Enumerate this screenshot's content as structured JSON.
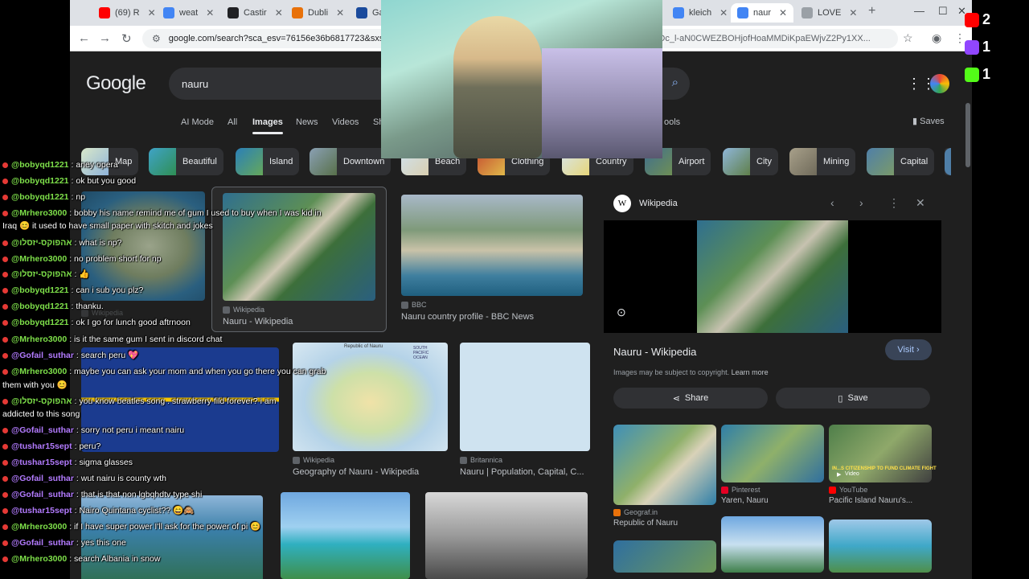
{
  "browser": {
    "tabs": [
      {
        "label": "(69) R",
        "color": "#ff0000",
        "active": false
      },
      {
        "label": "weat",
        "color": "#4285f4",
        "active": false
      },
      {
        "label": "Castir",
        "color": "#202124",
        "active": false
      },
      {
        "label": "Dubli",
        "color": "#e8710a",
        "active": false
      },
      {
        "label": "Ga",
        "color": "#1a4a9c",
        "active": false
      },
      {
        "label": "kleich",
        "color": "#4285f4",
        "active": false
      },
      {
        "label": "naur",
        "color": "#4285f4",
        "active": true
      },
      {
        "label": "LOVE",
        "color": "#9aa0a6",
        "active": false
      }
    ],
    "new_tab_icon": "+",
    "url": "google.com/search?sca_esv=76156e36b6817723&sxsr",
    "url_tail": "fbs=ADc_l-aN0CWEZBOHjofHoaMMDiKpaEWjvZ2Py1XX..."
  },
  "google": {
    "logo": "Google",
    "query": "nauru",
    "tabs": [
      "AI Mode",
      "All",
      "Images",
      "News",
      "Videos",
      "Sh",
      "ools"
    ],
    "active_tab": "Images",
    "saves": "Saves",
    "chips": [
      "Map",
      "Beautiful",
      "Island",
      "Downtown",
      "Beach",
      "Clothing",
      "Country",
      "Airport",
      "City",
      "Mining",
      "Capital"
    ],
    "results": [
      {
        "source": "Wikipedia",
        "caption": "Nauru - Wikipedia"
      },
      {
        "source": "BBC",
        "caption": "Nauru country profile - BBC News"
      },
      {
        "source": "Wikipedia",
        "caption": "Geography of Nauru - Wikipedia"
      },
      {
        "source": "Britannica",
        "caption": "Nauru | Population, Capital, C..."
      },
      {
        "source": "Wikipedia",
        "caption": "Nauru - Wikipedia"
      }
    ],
    "map_labels": {
      "title": "Republic of Nauru",
      "ocean": "SOUTH PACIFIC OCEAN"
    }
  },
  "panel": {
    "source": "Wikipedia",
    "title": "Nauru - Wikipedia",
    "visit": "Visit",
    "copyright": "Images may be subject to copyright.",
    "learn_more": "Learn more",
    "share": "Share",
    "save": "Save",
    "related": [
      {
        "source": "Geograf.in",
        "caption": "Republic of Nauru",
        "color": "#e8710a"
      },
      {
        "source": "Pinterest",
        "caption": "Yaren, Nauru",
        "color": "#e60023"
      },
      {
        "source": "YouTube",
        "caption": "Pacific Island Nauru's...",
        "color": "#ff0000"
      }
    ],
    "video_badge": "Video",
    "video_title": "IN...S CITIZENSHIP TO FUND CLIMATE FIGHT"
  },
  "stream_stats": [
    {
      "icon": "youtube-icon",
      "count": "2",
      "color": "#ff0000"
    },
    {
      "icon": "twitch-icon",
      "count": "1",
      "color": "#9146ff"
    },
    {
      "icon": "kick-icon",
      "count": "1",
      "color": "#53fc18"
    }
  ],
  "chat": [
    {
      "user": "@bobyqd1221",
      "text": ": aney opera",
      "color": "#7ee04a"
    },
    {
      "user": "@bobyqd1221",
      "text": ": ok but you good",
      "color": "#7ee04a"
    },
    {
      "user": "@bobyqd1221",
      "text": ": np",
      "color": "#7ee04a"
    },
    {
      "user": "@Mrhero3000",
      "text": ": bobby his name remind me of gum I used to buy when I was kid in",
      "color": "#7ee04a"
    },
    {
      "user": "",
      "text": "Iraq 😊 it used to have small paper with skitch and jokes",
      "color": "#ffffff"
    },
    {
      "user": "@אהפוקס-יזסלו",
      "text": ": what is np?",
      "color": "#7ee04a"
    },
    {
      "user": "@Mrhero3000",
      "text": ": no problem short for np",
      "color": "#7ee04a"
    },
    {
      "user": "@אהפוקס-יזסלו",
      "text": ": 👍",
      "color": "#7ee04a"
    },
    {
      "user": "@bobyqd1221",
      "text": ": can i sub you plz?",
      "color": "#7ee04a"
    },
    {
      "user": "@bobyqd1221",
      "text": ": thanku.",
      "color": "#7ee04a"
    },
    {
      "user": "@bobyqd1221",
      "text": ": ok I go for lunch good aftrnoon",
      "color": "#7ee04a"
    },
    {
      "user": "@Mrhero3000",
      "text": ": is it the same gum I sent in discord chat",
      "color": "#7ee04a"
    },
    {
      "user": "@Gofail_suthar",
      "text": ": search peru 💖",
      "color": "#b37bff"
    },
    {
      "user": "@Mrhero3000",
      "text": ": maybe you can ask your mom and when you go there you can grab",
      "color": "#7ee04a"
    },
    {
      "user": "",
      "text": "them with you 😊",
      "color": "#ffffff"
    },
    {
      "user": "@אהפוקס-יזסלו",
      "text": ": you know beatles song . strawberry fild forever? i am",
      "color": "#7ee04a"
    },
    {
      "user": "",
      "text": "addicted to this song",
      "color": "#ffffff"
    },
    {
      "user": "@Gofail_suthar",
      "text": ": sorry not peru i meant nairu",
      "color": "#b37bff"
    },
    {
      "user": "@tushar15sept",
      "text": ": peru?",
      "color": "#b37bff"
    },
    {
      "user": "@tushar15sept",
      "text": ": sigma glasses",
      "color": "#b37bff"
    },
    {
      "user": "@Gofail_suthar",
      "text": ": wut nairu is county wth",
      "color": "#b37bff"
    },
    {
      "user": "@Gofail_suthar",
      "text": ": that is that non lgbqhdtv type shi",
      "color": "#b37bff"
    },
    {
      "user": "@tushar15sept",
      "text": ": Nairo Quintana cyclist?? 😄🙈",
      "color": "#b37bff"
    },
    {
      "user": "@Mrhero3000",
      "text": ": if I have super power I'll ask for the power of pi 😊",
      "color": "#7ee04a"
    },
    {
      "user": "@Gofail_suthar",
      "text": ": yes this one",
      "color": "#b37bff"
    },
    {
      "user": "@Mrhero3000",
      "text": ": search Albania in snow",
      "color": "#7ee04a"
    }
  ]
}
